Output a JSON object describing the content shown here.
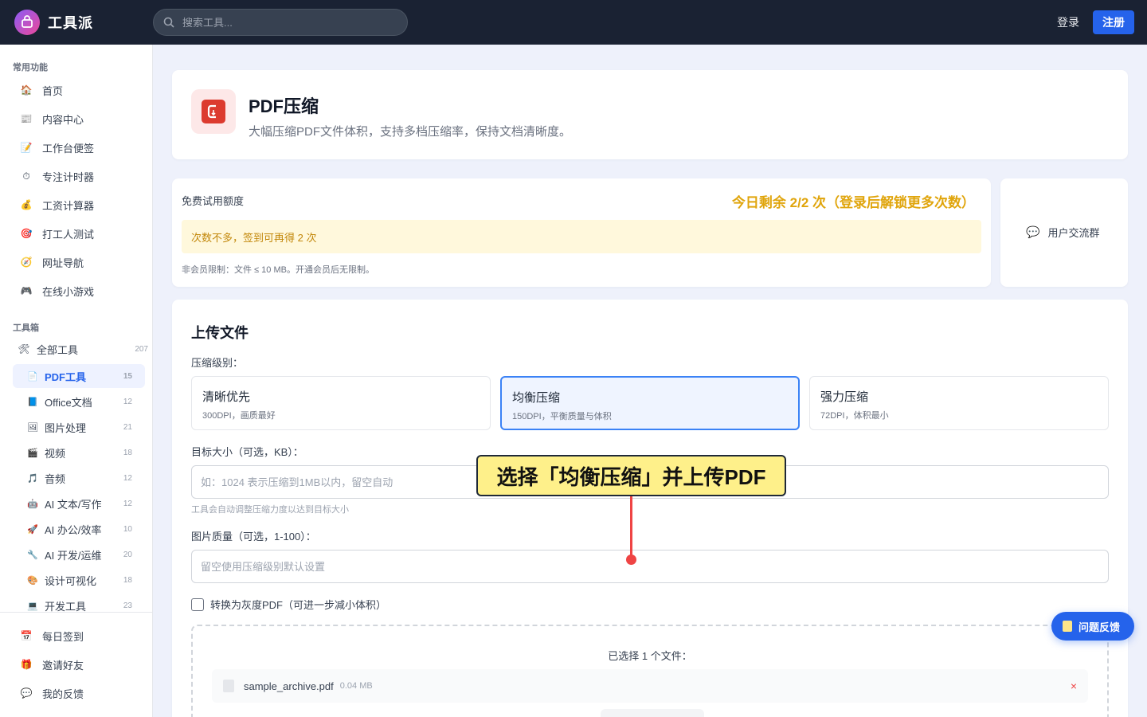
{
  "brand": {
    "name": "工具派"
  },
  "search": {
    "placeholder": "搜索工具..."
  },
  "header": {
    "login": "登录",
    "register": "注册"
  },
  "sidebar": {
    "common_title": "常用功能",
    "common": [
      {
        "label": "首页",
        "icon": "home-icon",
        "glyph": "🏠"
      },
      {
        "label": "内容中心",
        "icon": "newspaper-icon",
        "glyph": "📰"
      },
      {
        "label": "工作台便签",
        "icon": "note-icon",
        "glyph": "📝"
      },
      {
        "label": "专注计时器",
        "icon": "stopwatch-icon",
        "glyph": "⏱"
      },
      {
        "label": "工资计算器",
        "icon": "money-bag-icon",
        "glyph": "💰"
      },
      {
        "label": "打工人测试",
        "icon": "target-icon",
        "glyph": "🎯"
      },
      {
        "label": "网址导航",
        "icon": "compass-icon",
        "glyph": "🧭"
      },
      {
        "label": "在线小游戏",
        "icon": "gamepad-icon",
        "glyph": "🎮"
      }
    ],
    "toolbox_title": "工具箱",
    "all_tools": {
      "label": "全部工具",
      "count": "207",
      "icon": "tools-icon"
    },
    "categories": [
      {
        "label": "PDF工具",
        "count": "15",
        "icon": "pdf-icon",
        "glyph": "📄",
        "active": true
      },
      {
        "label": "Office文档",
        "count": "12",
        "icon": "office-doc-icon",
        "glyph": "📘"
      },
      {
        "label": "图片处理",
        "count": "21",
        "icon": "image-icon",
        "glyph": "🖼"
      },
      {
        "label": "视频",
        "count": "18",
        "icon": "video-icon",
        "glyph": "🎬"
      },
      {
        "label": "音频",
        "count": "12",
        "icon": "music-icon",
        "glyph": "🎵"
      },
      {
        "label": "AI 文本/写作",
        "count": "12",
        "icon": "robot-icon",
        "glyph": "🤖"
      },
      {
        "label": "AI 办公/效率",
        "count": "10",
        "icon": "rocket-icon",
        "glyph": "🚀"
      },
      {
        "label": "AI 开发/运维",
        "count": "20",
        "icon": "wrench-icon",
        "glyph": "🔧"
      },
      {
        "label": "设计可视化",
        "count": "18",
        "icon": "palette-icon",
        "glyph": "🎨"
      },
      {
        "label": "开发工具",
        "count": "23",
        "icon": "computer-icon",
        "glyph": "💻"
      }
    ],
    "bottom": [
      {
        "label": "每日签到",
        "icon": "calendar-icon",
        "glyph": "📅"
      },
      {
        "label": "邀请好友",
        "icon": "gift-icon",
        "glyph": "🎁"
      },
      {
        "label": "我的反馈",
        "icon": "speech-bubble-icon",
        "glyph": "💬"
      }
    ]
  },
  "hero": {
    "title": "PDF压缩",
    "description": "大幅压缩PDF文件体积，支持多档压缩率，保持文档清晰度。"
  },
  "quota": {
    "label": "免费试用额度",
    "remaining": "今日剩余 2/2 次（登录后解锁更多次数）",
    "tip": "次数不多，签到可再得 2 次",
    "note": "非会员限制：文件 ≤ 10 MB。开通会员后无限制。"
  },
  "group": {
    "label": "用户交流群"
  },
  "upload": {
    "title": "上传文件",
    "level_label": "压缩级别：",
    "levels": [
      {
        "title": "清晰优先",
        "sub": "300DPI，画质最好",
        "selected": false
      },
      {
        "title": "均衡压缩",
        "sub": "150DPI，平衡质量与体积",
        "selected": true
      },
      {
        "title": "强力压缩",
        "sub": "72DPI，体积最小",
        "selected": false
      }
    ],
    "target_label": "目标大小（可选，KB）：",
    "target_placeholder": "如：1024 表示压缩到1MB以内，留空自动",
    "target_hint": "工具会自动调整压缩力度以达到目标大小",
    "quality_label": "图片质量（可选，1-100）：",
    "quality_placeholder": "留空使用压缩级别默认设置",
    "grayscale_label": "转换为灰度PDF（可进一步减小体积）",
    "selected_title": "已选择 1 个文件：",
    "file": {
      "name": "sample_archive.pdf",
      "size": "0.04 MB",
      "remove": "×"
    }
  },
  "annotation": {
    "text": "选择「均衡压缩」并上传PDF"
  },
  "feedback": {
    "label": "问题反馈"
  },
  "colors": {
    "accent": "#2563eb",
    "topbar": "#1a2233",
    "quota": "#e0a50c",
    "pdf_red": "#dc3b2f",
    "callout": "#fef08a"
  }
}
